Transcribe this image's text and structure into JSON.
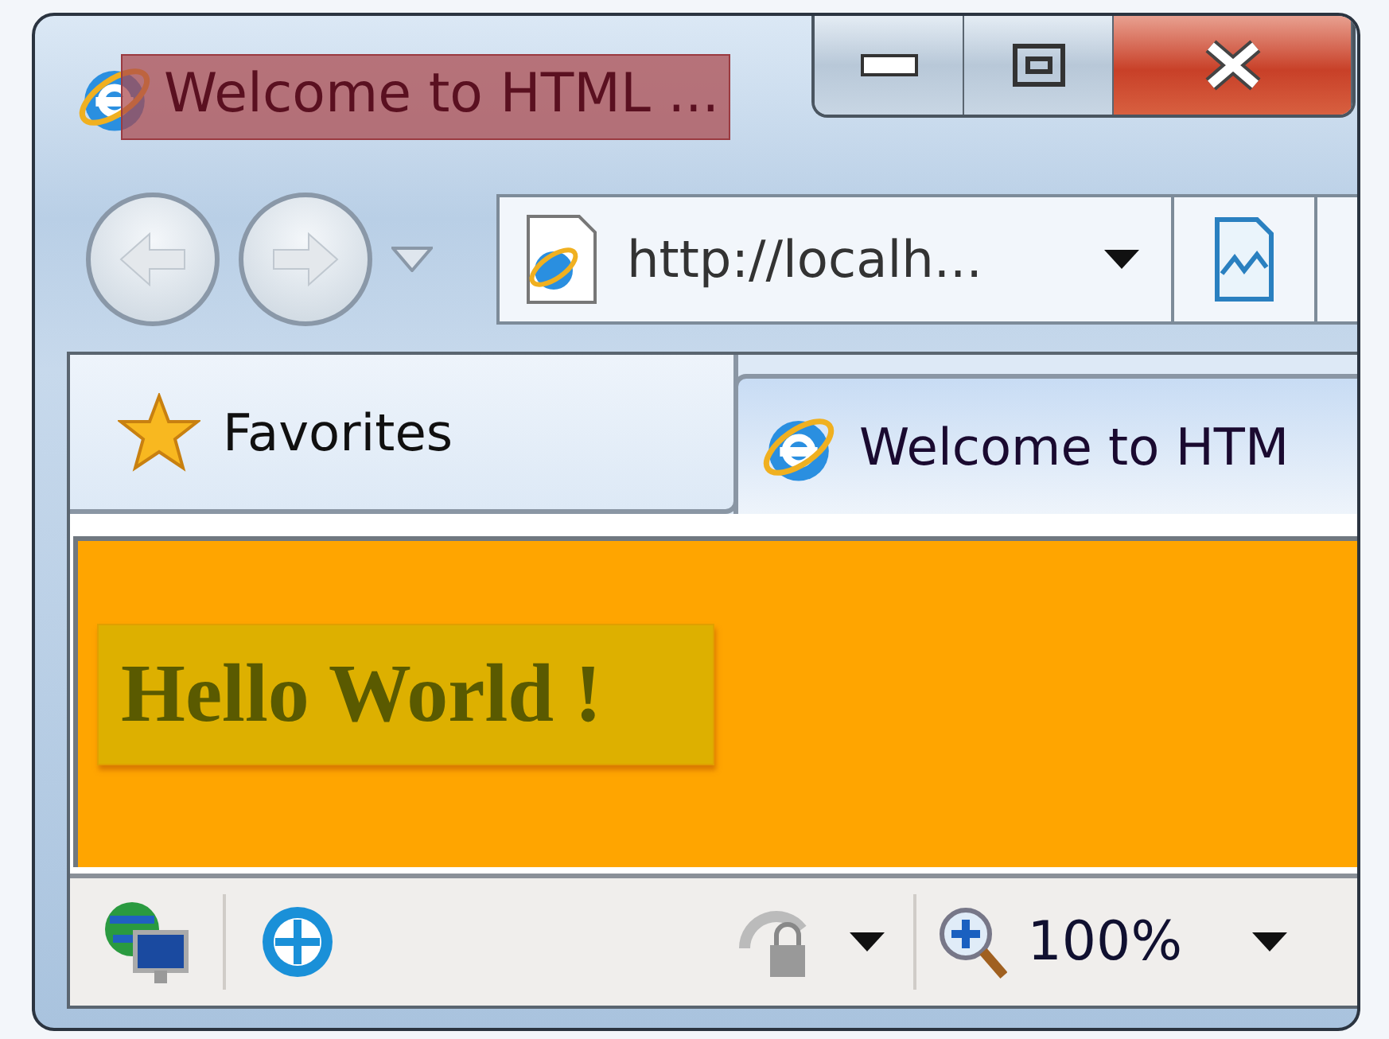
{
  "window": {
    "title": "Welcome to HTML ..."
  },
  "address_bar": {
    "value": "http://localh..."
  },
  "favorites_button": {
    "label": "Favorites"
  },
  "tabs": [
    {
      "label": "Welcome to HTM",
      "selected": true
    }
  ],
  "page": {
    "heading": "Hello World !"
  },
  "status_bar": {
    "zoom": "100%"
  }
}
